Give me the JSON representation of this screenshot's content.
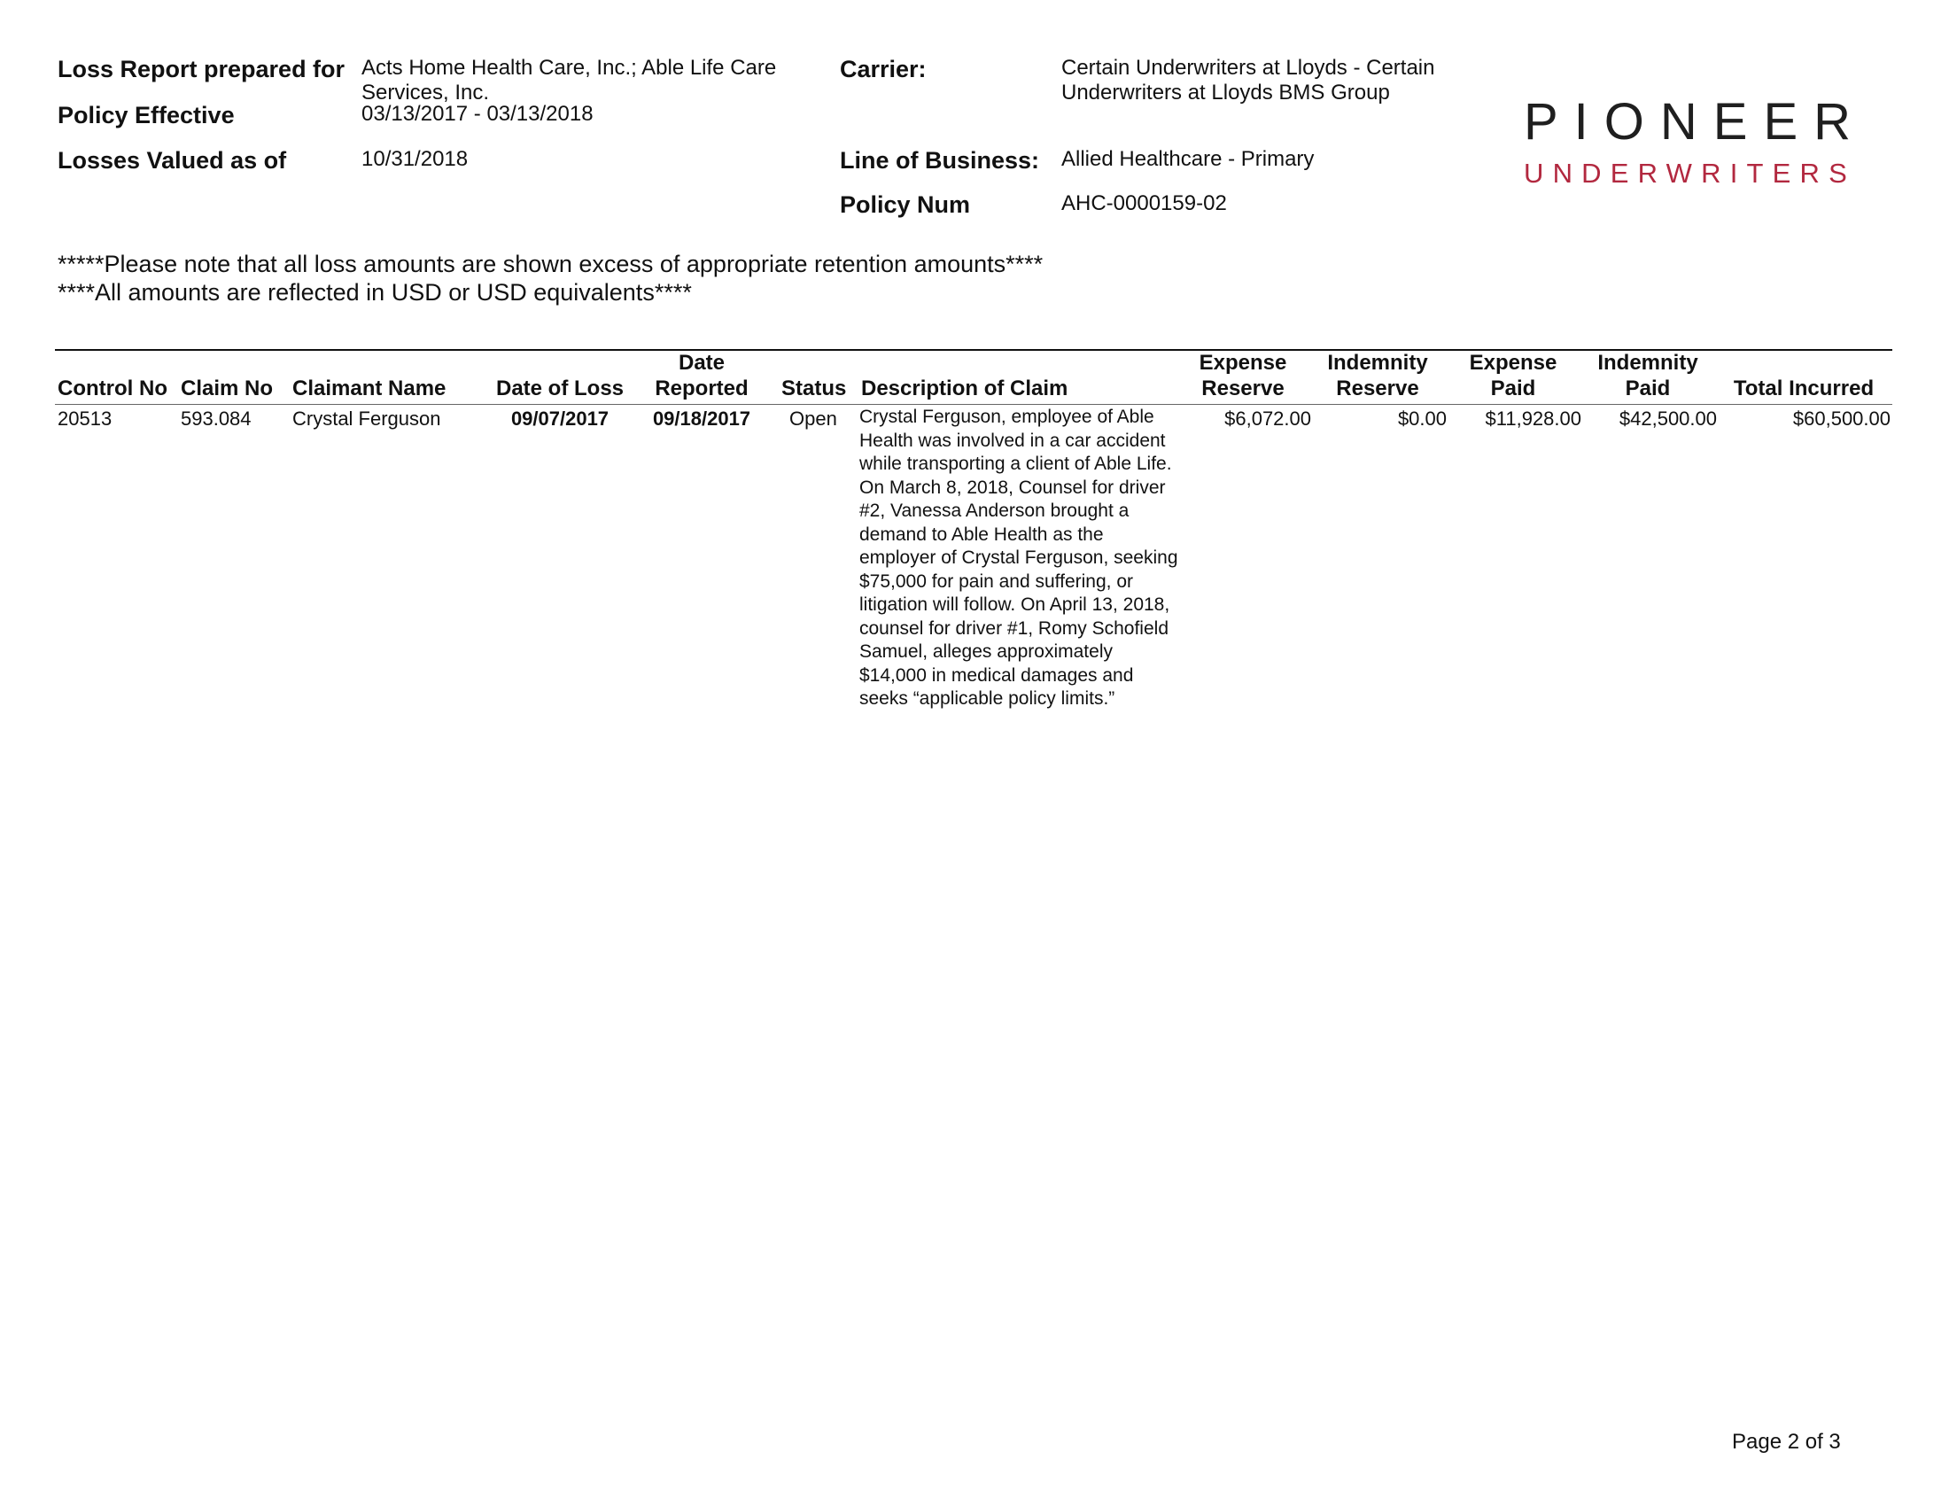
{
  "header": {
    "prepared_for_label": "Loss Report prepared for",
    "prepared_for_value": "Acts Home Health Care, Inc.; Able Life Care Services, Inc.",
    "policy_effective_label": "Policy Effective",
    "policy_effective_value": "03/13/2017 - 03/13/2018",
    "losses_valued_label": "Losses Valued as of",
    "losses_valued_value": "10/31/2018",
    "carrier_label": "Carrier:",
    "carrier_value": "Certain Underwriters at Lloyds - Certain Underwriters at Lloyds BMS Group",
    "line_of_business_label": "Line of Business:",
    "line_of_business_value": "Allied Healthcare - Primary",
    "policy_num_label": "Policy Num",
    "policy_num_value": "AHC-0000159-02"
  },
  "logo": {
    "word": "PIONEER",
    "sub": "UNDERWRITERS",
    "word_color": "#1f1f1f",
    "sub_color": "#b2283f"
  },
  "notes": {
    "line1": "*****Please note that all loss amounts are shown excess of appropriate retention amounts****",
    "line2": "****All amounts are reflected in USD or USD equivalents****"
  },
  "table": {
    "headers": {
      "control_no": "Control No",
      "claim_no": "Claim No",
      "claimant_name": "Claimant Name",
      "date_of_loss": "Date of Loss",
      "date_reported_1": "Date",
      "date_reported_2": "Reported",
      "status": "Status",
      "description": "Description of Claim",
      "expense_reserve_1": "Expense",
      "expense_reserve_2": "Reserve",
      "indemnity_reserve_1": "Indemnity",
      "indemnity_reserve_2": "Reserve",
      "expense_paid_1": "Expense",
      "expense_paid_2": "Paid",
      "indemnity_paid_1": "Indemnity",
      "indemnity_paid_2": "Paid",
      "total_incurred": "Total Incurred"
    },
    "rows": [
      {
        "control_no": "20513",
        "claim_no": "593.084",
        "claimant_name": "Crystal Ferguson",
        "date_of_loss": "09/07/2017",
        "date_reported": "09/18/2017",
        "status": "Open",
        "description": "Crystal Ferguson, employee of Able Health was involved in a car accident while transporting a client of Able Life. On March 8, 2018, Counsel for driver #2, Vanessa Anderson brought a demand to Able Health as the employer of Crystal Ferguson, seeking $75,000 for pain and suffering, or litigation will follow. On April 13, 2018, counsel for driver #1, Romy Schofield Samuel, alleges approximately $14,000 in medical damages and seeks “applicable policy limits.”",
        "expense_reserve": "$6,072.00",
        "indemnity_reserve": "$0.00",
        "expense_paid": "$11,928.00",
        "indemnity_paid": "$42,500.00",
        "total_incurred": "$60,500.00"
      }
    ]
  },
  "footer": {
    "page": "Page 2 of 3"
  }
}
